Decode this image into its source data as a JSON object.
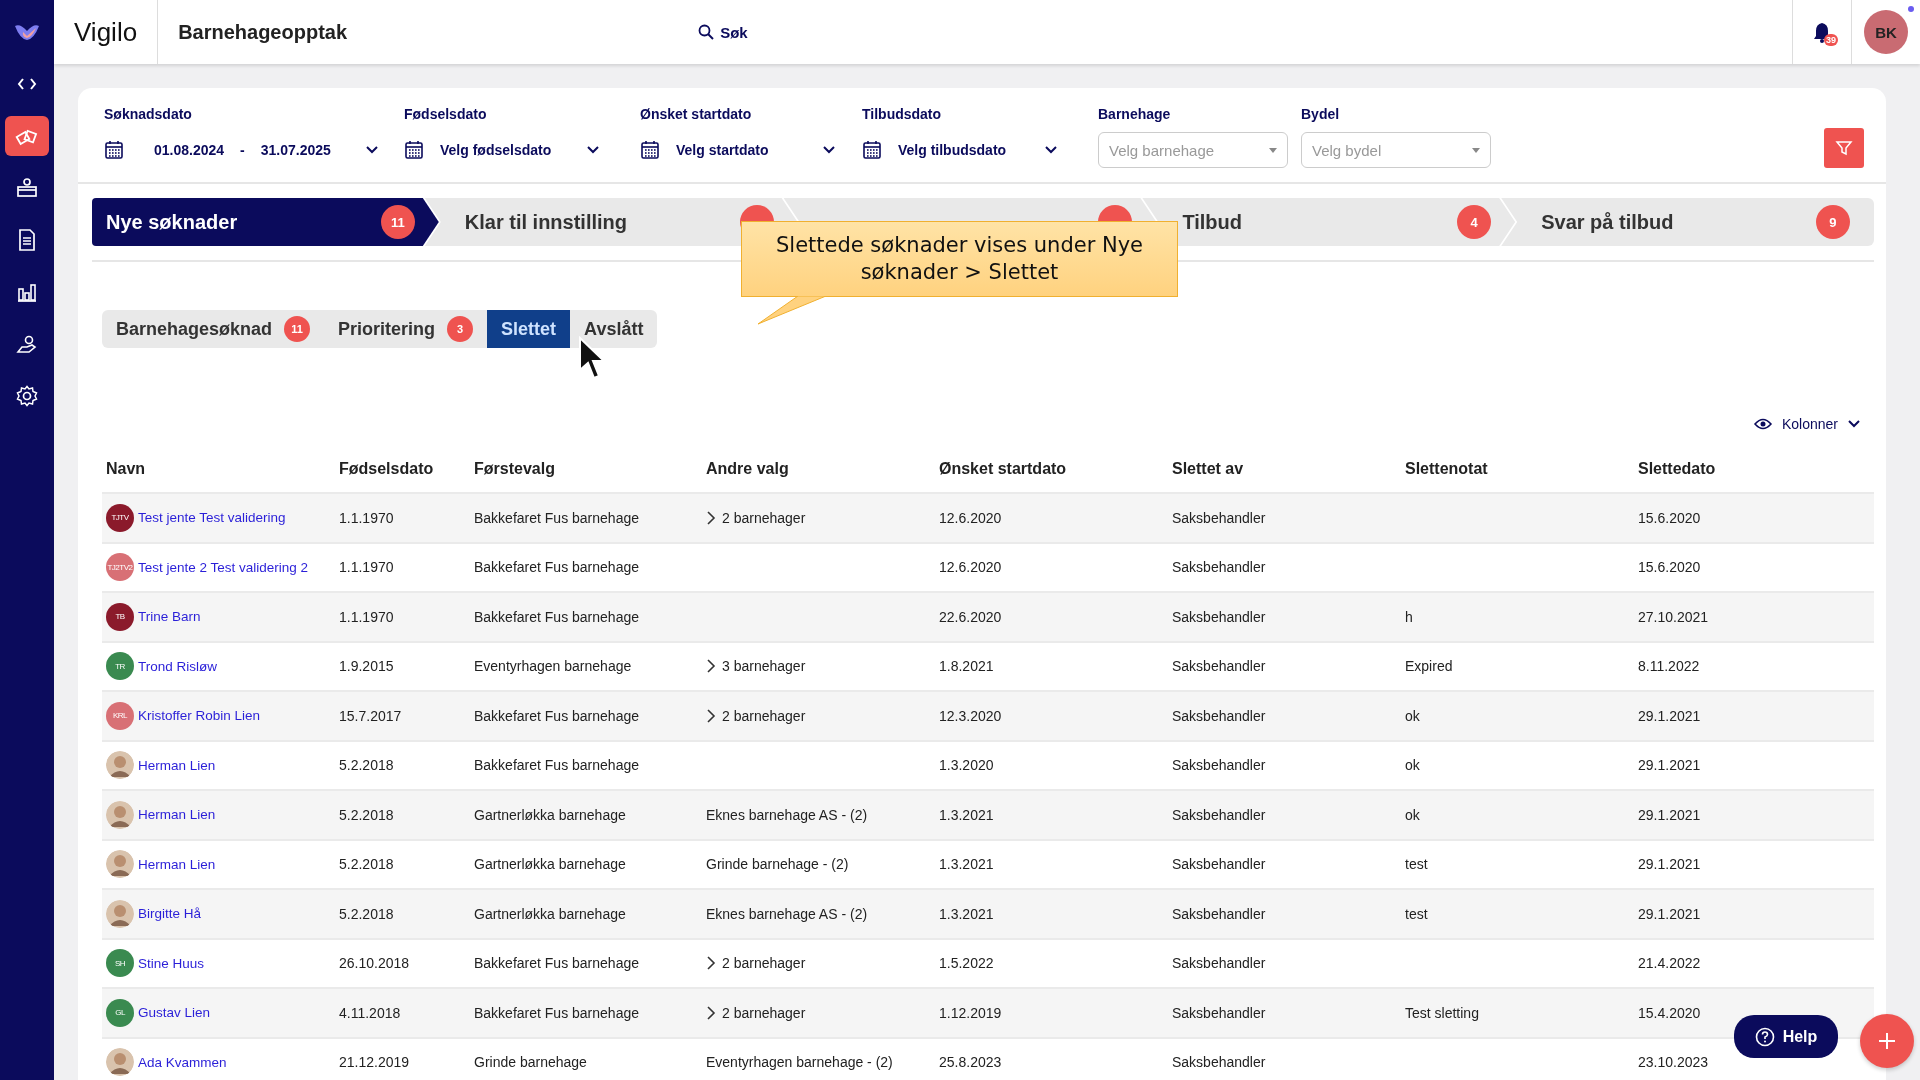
{
  "header": {
    "logo": "Vigilo",
    "module": "Barnehageopptak",
    "search": "Søk",
    "notifications": "39",
    "user": "BK"
  },
  "sidebar": [
    {
      "kind": "code",
      "selected": false
    },
    {
      "kind": "blocks",
      "selected": true
    },
    {
      "kind": "kiosk",
      "selected": false
    },
    {
      "kind": "document",
      "selected": false
    },
    {
      "kind": "chart",
      "selected": false
    },
    {
      "kind": "hand",
      "selected": false
    },
    {
      "kind": "gear",
      "selected": false
    }
  ],
  "filters": [
    {
      "kind": "daterange",
      "label": "Søknadsdato",
      "from": "01.08.2024",
      "separator": "-",
      "to": "31.07.2025"
    },
    {
      "kind": "date",
      "label": "Fødselsdato",
      "placeholder": "Velg fødselsdato"
    },
    {
      "kind": "date",
      "label": "Ønsket startdato",
      "placeholder": "Velg startdato"
    },
    {
      "kind": "date",
      "label": "Tilbudsdato",
      "placeholder": "Velg tilbudsdato"
    },
    {
      "kind": "select",
      "label": "Barnehage",
      "placeholder": "Velg barnehage"
    },
    {
      "kind": "select",
      "label": "Bydel",
      "placeholder": "Velg bydel"
    }
  ],
  "steps": [
    {
      "label": "Nye søknader",
      "count": "11",
      "selected": true
    },
    {
      "label": "Klar til innstilling",
      "selected": false
    },
    {
      "selected": false
    },
    {
      "label": "Tilbud",
      "count": "4",
      "selected": false
    },
    {
      "label": "Svar på tilbud",
      "count": "9",
      "selected": false
    }
  ],
  "callout": "Slettede søknader vises under Nye søknader > Slettet",
  "subtabs": [
    {
      "label": "Barnehagesøknad",
      "count": "11",
      "selected": false
    },
    {
      "label": "Prioritering",
      "count": "3",
      "selected": false
    },
    {
      "label": "Slettet",
      "selected": true
    },
    {
      "label": "Avslått",
      "selected": false
    }
  ],
  "columns_button": "Kolonner",
  "table": {
    "columns": [
      "Navn",
      "Fødselsdato",
      "Førstevalg",
      "Andre valg",
      "Ønsket startdato",
      "Slettet av",
      "Slettenotat",
      "Slettedato"
    ],
    "rows": [
      {
        "avatar": {
          "kind": "initials",
          "initials": "TJTV",
          "color": "#8b1a2b"
        },
        "name": "Test jente Test validering",
        "birth": "1.1.1970",
        "first": "Bakkefaret Fus barnehage",
        "expandable": true,
        "other": "2 barnehager",
        "start": "12.6.2020",
        "deleted_by": "Saksbehandler",
        "deleted_date": "15.6.2020"
      },
      {
        "avatar": {
          "kind": "initials",
          "initials": "TJ2TV2",
          "color": "#d87075"
        },
        "name": "Test jente 2 Test validering 2",
        "birth": "1.1.1970",
        "first": "Bakkefaret Fus barnehage",
        "expandable": false,
        "start": "12.6.2020",
        "deleted_by": "Saksbehandler",
        "deleted_date": "15.6.2020"
      },
      {
        "avatar": {
          "kind": "initials",
          "initials": "TB",
          "color": "#8b1a2b"
        },
        "name": "Trine Barn",
        "birth": "1.1.1970",
        "first": "Bakkefaret Fus barnehage",
        "expandable": false,
        "start": "22.6.2020",
        "deleted_by": "Saksbehandler",
        "note": "h",
        "deleted_date": "27.10.2021"
      },
      {
        "avatar": {
          "kind": "initials",
          "initials": "TR",
          "color": "#3a8a50"
        },
        "name": "Trond Risløw",
        "birth": "1.9.2015",
        "first": "Eventyrhagen barnehage",
        "expandable": true,
        "other": "3 barnehager",
        "start": "1.8.2021",
        "deleted_by": "Saksbehandler",
        "note": "Expired",
        "deleted_date": "8.11.2022"
      },
      {
        "avatar": {
          "kind": "initials",
          "initials": "KRL",
          "color": "#d87075"
        },
        "name": "Kristoffer Robin Lien",
        "birth": "15.7.2017",
        "first": "Bakkefaret Fus barnehage",
        "expandable": true,
        "other": "2 barnehager",
        "start": "12.3.2020",
        "deleted_by": "Saksbehandler",
        "note": "ok",
        "deleted_date": "29.1.2021"
      },
      {
        "avatar": {
          "kind": "photo"
        },
        "name": "Herman Lien",
        "birth": "5.2.2018",
        "first": "Bakkefaret Fus barnehage",
        "expandable": false,
        "start": "1.3.2020",
        "deleted_by": "Saksbehandler",
        "note": "ok",
        "deleted_date": "29.1.2021"
      },
      {
        "avatar": {
          "kind": "photo"
        },
        "name": "Herman Lien",
        "birth": "5.2.2018",
        "first": "Gartnerløkka barnehage",
        "expandable": false,
        "other": "Eknes barnehage AS - (2)",
        "start": "1.3.2021",
        "deleted_by": "Saksbehandler",
        "note": "ok",
        "deleted_date": "29.1.2021"
      },
      {
        "avatar": {
          "kind": "photo"
        },
        "name": "Herman Lien",
        "birth": "5.2.2018",
        "first": "Gartnerløkka barnehage",
        "expandable": false,
        "other": "Grinde barnehage - (2)",
        "start": "1.3.2021",
        "deleted_by": "Saksbehandler",
        "note": "test",
        "deleted_date": "29.1.2021"
      },
      {
        "avatar": {
          "kind": "photo"
        },
        "name": "Birgitte Hå",
        "birth": "5.2.2018",
        "first": "Gartnerløkka barnehage",
        "expandable": false,
        "other": "Eknes barnehage AS - (2)",
        "start": "1.3.2021",
        "deleted_by": "Saksbehandler",
        "note": "test",
        "deleted_date": "29.1.2021"
      },
      {
        "avatar": {
          "kind": "initials",
          "initials": "SH",
          "color": "#3a8a50"
        },
        "name": "Stine Huus",
        "birth": "26.10.2018",
        "first": "Bakkefaret Fus barnehage",
        "expandable": true,
        "other": "2 barnehager",
        "start": "1.5.2022",
        "deleted_by": "Saksbehandler",
        "deleted_date": "21.4.2022"
      },
      {
        "avatar": {
          "kind": "initials",
          "initials": "GL",
          "color": "#3a8a50"
        },
        "name": "Gustav Lien",
        "birth": "4.11.2018",
        "first": "Bakkefaret Fus barnehage",
        "expandable": true,
        "other": "2 barnehager",
        "start": "1.12.2019",
        "deleted_by": "Saksbehandler",
        "note": "Test sletting",
        "deleted_date": "15.4.2020"
      },
      {
        "avatar": {
          "kind": "photo"
        },
        "name": "Ada Kvammen",
        "birth": "21.12.2019",
        "first": "Grinde barnehage",
        "expandable": false,
        "other": "Eventyrhagen barnehage - (2)",
        "start": "25.8.2023",
        "deleted_by": "Saksbehandler",
        "deleted_date": "23.10.2023"
      }
    ]
  },
  "help": "Help"
}
